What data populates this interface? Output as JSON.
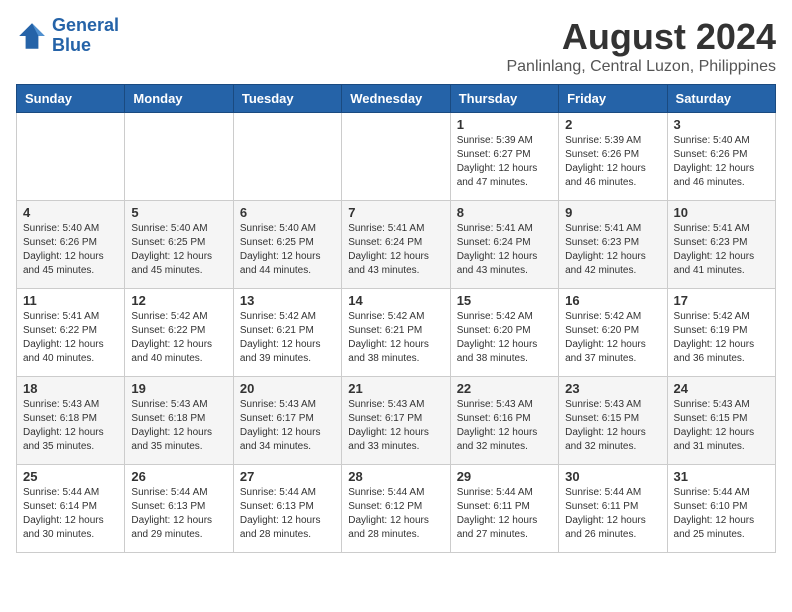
{
  "header": {
    "logo_line1": "General",
    "logo_line2": "Blue",
    "title": "August 2024",
    "subtitle": "Panlinlang, Central Luzon, Philippines"
  },
  "days_of_week": [
    "Sunday",
    "Monday",
    "Tuesday",
    "Wednesday",
    "Thursday",
    "Friday",
    "Saturday"
  ],
  "weeks": [
    [
      {
        "day": "",
        "info": ""
      },
      {
        "day": "",
        "info": ""
      },
      {
        "day": "",
        "info": ""
      },
      {
        "day": "",
        "info": ""
      },
      {
        "day": "1",
        "info": "Sunrise: 5:39 AM\nSunset: 6:27 PM\nDaylight: 12 hours\nand 47 minutes."
      },
      {
        "day": "2",
        "info": "Sunrise: 5:39 AM\nSunset: 6:26 PM\nDaylight: 12 hours\nand 46 minutes."
      },
      {
        "day": "3",
        "info": "Sunrise: 5:40 AM\nSunset: 6:26 PM\nDaylight: 12 hours\nand 46 minutes."
      }
    ],
    [
      {
        "day": "4",
        "info": "Sunrise: 5:40 AM\nSunset: 6:26 PM\nDaylight: 12 hours\nand 45 minutes."
      },
      {
        "day": "5",
        "info": "Sunrise: 5:40 AM\nSunset: 6:25 PM\nDaylight: 12 hours\nand 45 minutes."
      },
      {
        "day": "6",
        "info": "Sunrise: 5:40 AM\nSunset: 6:25 PM\nDaylight: 12 hours\nand 44 minutes."
      },
      {
        "day": "7",
        "info": "Sunrise: 5:41 AM\nSunset: 6:24 PM\nDaylight: 12 hours\nand 43 minutes."
      },
      {
        "day": "8",
        "info": "Sunrise: 5:41 AM\nSunset: 6:24 PM\nDaylight: 12 hours\nand 43 minutes."
      },
      {
        "day": "9",
        "info": "Sunrise: 5:41 AM\nSunset: 6:23 PM\nDaylight: 12 hours\nand 42 minutes."
      },
      {
        "day": "10",
        "info": "Sunrise: 5:41 AM\nSunset: 6:23 PM\nDaylight: 12 hours\nand 41 minutes."
      }
    ],
    [
      {
        "day": "11",
        "info": "Sunrise: 5:41 AM\nSunset: 6:22 PM\nDaylight: 12 hours\nand 40 minutes."
      },
      {
        "day": "12",
        "info": "Sunrise: 5:42 AM\nSunset: 6:22 PM\nDaylight: 12 hours\nand 40 minutes."
      },
      {
        "day": "13",
        "info": "Sunrise: 5:42 AM\nSunset: 6:21 PM\nDaylight: 12 hours\nand 39 minutes."
      },
      {
        "day": "14",
        "info": "Sunrise: 5:42 AM\nSunset: 6:21 PM\nDaylight: 12 hours\nand 38 minutes."
      },
      {
        "day": "15",
        "info": "Sunrise: 5:42 AM\nSunset: 6:20 PM\nDaylight: 12 hours\nand 38 minutes."
      },
      {
        "day": "16",
        "info": "Sunrise: 5:42 AM\nSunset: 6:20 PM\nDaylight: 12 hours\nand 37 minutes."
      },
      {
        "day": "17",
        "info": "Sunrise: 5:42 AM\nSunset: 6:19 PM\nDaylight: 12 hours\nand 36 minutes."
      }
    ],
    [
      {
        "day": "18",
        "info": "Sunrise: 5:43 AM\nSunset: 6:18 PM\nDaylight: 12 hours\nand 35 minutes."
      },
      {
        "day": "19",
        "info": "Sunrise: 5:43 AM\nSunset: 6:18 PM\nDaylight: 12 hours\nand 35 minutes."
      },
      {
        "day": "20",
        "info": "Sunrise: 5:43 AM\nSunset: 6:17 PM\nDaylight: 12 hours\nand 34 minutes."
      },
      {
        "day": "21",
        "info": "Sunrise: 5:43 AM\nSunset: 6:17 PM\nDaylight: 12 hours\nand 33 minutes."
      },
      {
        "day": "22",
        "info": "Sunrise: 5:43 AM\nSunset: 6:16 PM\nDaylight: 12 hours\nand 32 minutes."
      },
      {
        "day": "23",
        "info": "Sunrise: 5:43 AM\nSunset: 6:15 PM\nDaylight: 12 hours\nand 32 minutes."
      },
      {
        "day": "24",
        "info": "Sunrise: 5:43 AM\nSunset: 6:15 PM\nDaylight: 12 hours\nand 31 minutes."
      }
    ],
    [
      {
        "day": "25",
        "info": "Sunrise: 5:44 AM\nSunset: 6:14 PM\nDaylight: 12 hours\nand 30 minutes."
      },
      {
        "day": "26",
        "info": "Sunrise: 5:44 AM\nSunset: 6:13 PM\nDaylight: 12 hours\nand 29 minutes."
      },
      {
        "day": "27",
        "info": "Sunrise: 5:44 AM\nSunset: 6:13 PM\nDaylight: 12 hours\nand 28 minutes."
      },
      {
        "day": "28",
        "info": "Sunrise: 5:44 AM\nSunset: 6:12 PM\nDaylight: 12 hours\nand 28 minutes."
      },
      {
        "day": "29",
        "info": "Sunrise: 5:44 AM\nSunset: 6:11 PM\nDaylight: 12 hours\nand 27 minutes."
      },
      {
        "day": "30",
        "info": "Sunrise: 5:44 AM\nSunset: 6:11 PM\nDaylight: 12 hours\nand 26 minutes."
      },
      {
        "day": "31",
        "info": "Sunrise: 5:44 AM\nSunset: 6:10 PM\nDaylight: 12 hours\nand 25 minutes."
      }
    ]
  ]
}
